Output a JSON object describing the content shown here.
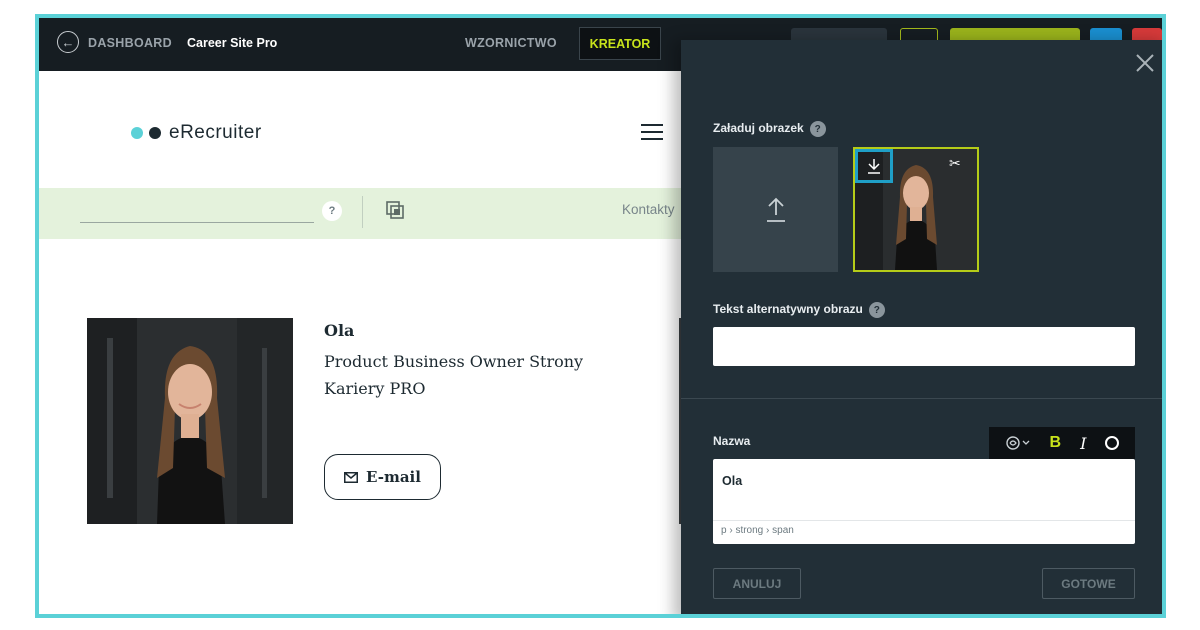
{
  "topbar": {
    "dashboard_label": "DASHBOARD",
    "site_title": "Career Site Pro",
    "nav_design": "WZORNICTWO",
    "nav_creator": "KREATOR",
    "creator_color": "#c8e31b"
  },
  "page": {
    "logo_text": "eRecruiter",
    "help_label": "?",
    "contacts_label": "Kontakty",
    "person": {
      "name": "Ola",
      "role": "Product Business Owner Strony Kariery PRO",
      "email_label": "E-mail"
    }
  },
  "panel": {
    "upload_label": "Załaduj obrazek",
    "alt_label": "Tekst alternatywny obrazu",
    "alt_value": "",
    "name_label": "Nazwa",
    "name_value": "Ola",
    "breadcrumb": "p › strong › span",
    "toolbar": {
      "bold": "B",
      "italic": "I"
    },
    "cancel_label": "ANULUJ",
    "done_label": "GOTOWE",
    "help_glyph": "?"
  },
  "colors": {
    "accent_teal": "#5bd1d7",
    "accent_lime": "#b5cc18",
    "panel_bg": "#222f37",
    "topbar_bg": "#161d22"
  }
}
